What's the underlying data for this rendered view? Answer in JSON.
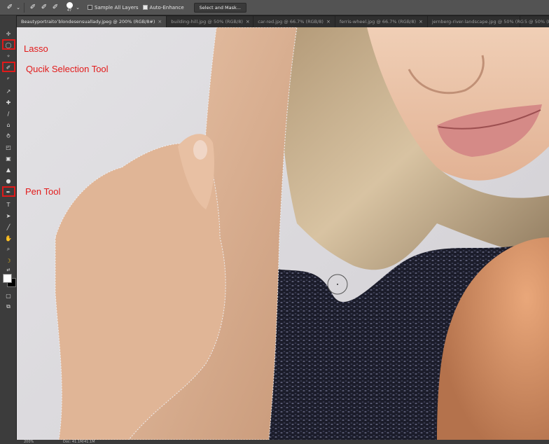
{
  "options_bar": {
    "brush_size": "47",
    "sample_all_layers_label": "Sample All Layers",
    "sample_all_layers_checked": false,
    "auto_enhance_label": "Auto-Enhance",
    "auto_enhance_checked": true,
    "select_mask_label": "Select and Mask..."
  },
  "tabs": [
    {
      "label": "Beautyportraito’blondesensuallady.jpeg @ 200% (RGB/8#)",
      "active": true
    },
    {
      "label": "building-hill.jpg @ 50% (RGB/8)",
      "active": false
    },
    {
      "label": "car-red.jpg @ 66.7% (RGB/8)",
      "active": false
    },
    {
      "label": "ferris-wheel.jpg @ 66.7% (RGB/8)",
      "active": false
    },
    {
      "label": "jernberg-river-landscape.jpg @ 50% (RG",
      "active": false
    },
    {
      "label": "5 @ 50% (RG",
      "active": false
    }
  ],
  "tools": [
    "move-tool",
    "lasso-tool",
    "quick-selection-tool",
    "crop-tool",
    "eyedropper-tool",
    "healing-brush-tool",
    "brush-tool",
    "clone-stamp-tool",
    "history-brush-tool",
    "eraser-tool",
    "gradient-tool",
    "blur-tool",
    "dodge-tool",
    "pen-tool",
    "type-tool",
    "path-selection-tool",
    "line-tool",
    "hand-tool",
    "zoom-tool",
    "extra-tool"
  ],
  "callouts": {
    "lasso": "Lasso",
    "quick_selection": "Qucik Selection Tool",
    "pen": "Pen Tool"
  },
  "status": {
    "zoom": "200%",
    "doc": "Doc: 41.1M/41.1M"
  },
  "colors": {
    "callout_red": "#e01a1a",
    "foreground": "#ffffff",
    "background": "#000000"
  }
}
